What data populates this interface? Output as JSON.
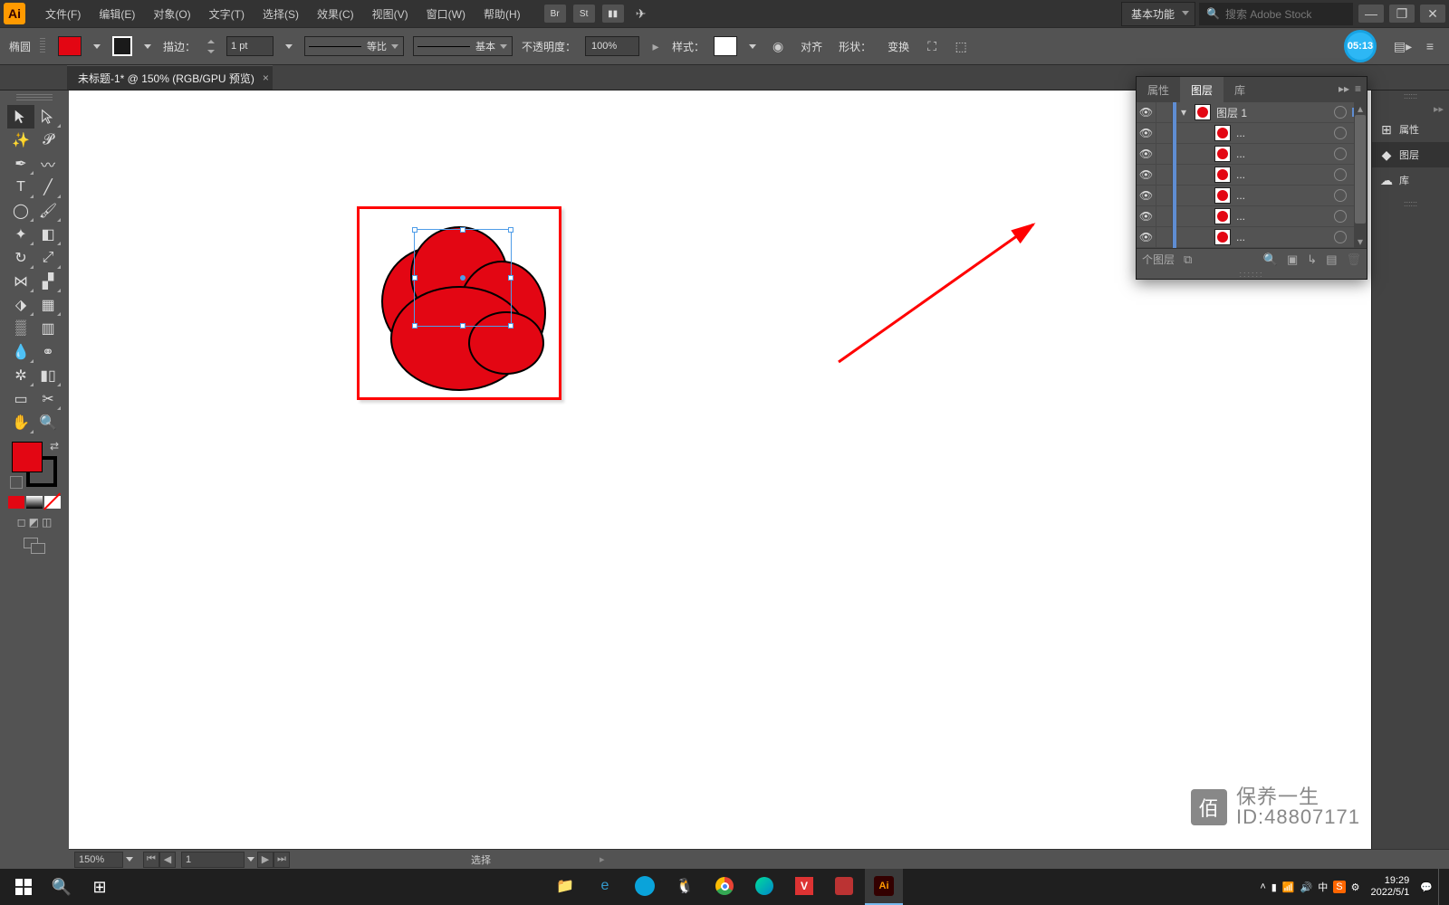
{
  "app": {
    "icon_label": "Ai",
    "workspace": "基本功能",
    "search_placeholder": "搜索 Adobe Stock"
  },
  "menu": [
    "文件(F)",
    "编辑(E)",
    "对象(O)",
    "文字(T)",
    "选择(S)",
    "效果(C)",
    "视图(V)",
    "窗口(W)",
    "帮助(H)"
  ],
  "timer": "05:13",
  "controlbar": {
    "tool_name": "椭圆",
    "stroke_label": "描边：",
    "stroke_weight": "1 pt",
    "profile_label": "等比",
    "brush_label": "基本",
    "opacity_label": "不透明度：",
    "opacity_value": "100%",
    "style_label": "样式：",
    "align_label": "对齐",
    "shape_label": "形状：",
    "transform_label": "变换"
  },
  "doc_tab": "未标题-1* @ 150% (RGB/GPU 预览)",
  "right_dock": {
    "properties": "属性",
    "layers": "图层",
    "libraries": "库"
  },
  "layers_panel": {
    "tabs": {
      "properties": "属性",
      "layers": "图层",
      "libraries": "库"
    },
    "top_layer": "图层 1",
    "sublayer_label": "...",
    "footer_count": "个图层"
  },
  "status": {
    "zoom": "150%",
    "page": "1",
    "tool_status": "选择"
  },
  "taskbar": {
    "time": "19:29",
    "date": "2022/5/1",
    "ime": "中"
  },
  "watermark": {
    "line1": "保养一生",
    "line2": "ID:48807171"
  }
}
